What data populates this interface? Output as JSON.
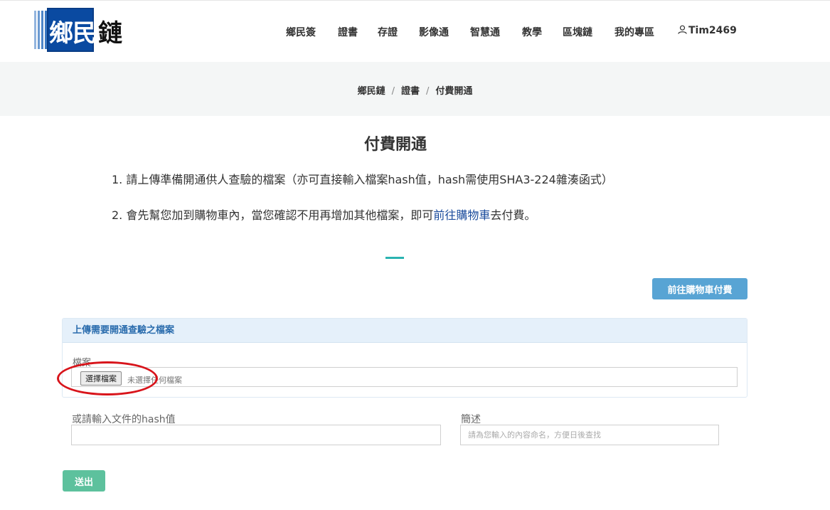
{
  "logo": {
    "box_text": "鄉民",
    "tail_text": "鏈"
  },
  "nav": {
    "items": [
      "鄉民簽",
      "證書",
      "存證",
      "影像通",
      "智慧通",
      "教學",
      "區塊鏈",
      "我的專區"
    ],
    "user": "Tim2469"
  },
  "breadcrumb": [
    "鄉民鏈",
    "證書",
    "付費開通"
  ],
  "page": {
    "title": "付費開通",
    "step1": "1. 請上傳準備開通供人查驗的檔案（亦可直接輸入檔案hash值，hash需使用SHA3-224雜湊函式）",
    "step2_prefix": "2. 會先幫您加到購物車內，當您確認不用再增加其他檔案，即可",
    "step2_link": "前往購物車",
    "step2_suffix": "去付費。"
  },
  "cart_button": "前往購物車付費",
  "upload_panel": {
    "heading": "上傳需要開通查驗之檔案",
    "file_label": "檔案",
    "choose_button": "選擇檔案",
    "no_file_text": "未選擇任何檔案"
  },
  "hash_field": {
    "label": "或請輸入文件的hash值",
    "value": "",
    "placeholder": ""
  },
  "desc_field": {
    "label": "簡述",
    "value": "",
    "placeholder": "請為您輸入的內容命名，方便日後查找"
  },
  "submit_button": "送出",
  "colors": {
    "logo_blue": "#0a4aa1",
    "link_blue": "#1a4b9c",
    "cart_button": "#58a4d4",
    "submit_button": "#5dc19d",
    "accent_line": "#2bb3b1",
    "annotation_red": "#d8141b"
  }
}
